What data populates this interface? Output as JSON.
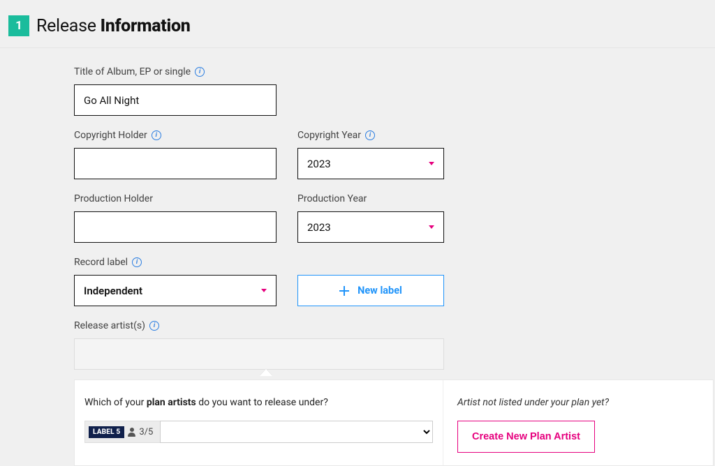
{
  "header": {
    "step": "1",
    "title_light": "Release ",
    "title_bold": "Information"
  },
  "form": {
    "title": {
      "label": "Title of Album, EP or single",
      "value": "Go All Night"
    },
    "copyright_holder": {
      "label": "Copyright Holder",
      "value": ""
    },
    "copyright_year": {
      "label": "Copyright Year",
      "value": "2023"
    },
    "production_holder": {
      "label": "Production Holder",
      "value": ""
    },
    "production_year": {
      "label": "Production Year",
      "value": "2023"
    },
    "record_label": {
      "label": "Record label",
      "value": "Independent"
    },
    "new_label_btn": "New label",
    "release_artists": {
      "label": "Release artist(s)"
    }
  },
  "plan": {
    "question_prefix": "Which of your ",
    "question_bold": "plan artists",
    "question_suffix": " do you want to release under?",
    "chip": "LABEL 5",
    "count": "3/5",
    "not_listed": "Artist not listed under your plan yet?",
    "create_btn": "Create New Plan Artist"
  }
}
